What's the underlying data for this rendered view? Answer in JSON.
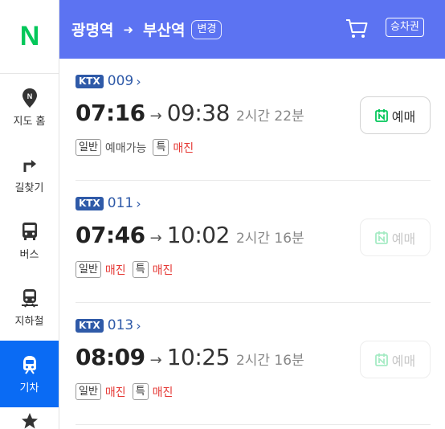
{
  "sidebar": {
    "logo": "N",
    "items": [
      {
        "label": "지도 홈",
        "icon": "map-pin-icon"
      },
      {
        "label": "길찾기",
        "icon": "turn-right-arrow-icon"
      },
      {
        "label": "버스",
        "icon": "bus-icon"
      },
      {
        "label": "지하철",
        "icon": "subway-icon"
      },
      {
        "label": "기차",
        "icon": "train-icon",
        "active": true
      }
    ]
  },
  "header": {
    "from": "광명역",
    "to": "부산역",
    "arrow": "➜",
    "change_label": "변경",
    "ticket_label": "승차권"
  },
  "trains": [
    {
      "type": "KTX",
      "number": "009",
      "departure": "07:16",
      "arrival": "09:38",
      "duration": "2시간 22분",
      "general_label": "일반",
      "general_status": "예매가능",
      "special_label": "특",
      "special_status": "매진",
      "book_label": "예매",
      "bookable": true
    },
    {
      "type": "KTX",
      "number": "011",
      "departure": "07:46",
      "arrival": "10:02",
      "duration": "2시간 16분",
      "general_label": "일반",
      "general_status": "매진",
      "special_label": "특",
      "special_status": "매진",
      "book_label": "예매",
      "bookable": false
    },
    {
      "type": "KTX",
      "number": "013",
      "departure": "08:09",
      "arrival": "10:25",
      "duration": "2시간 16분",
      "general_label": "일반",
      "general_status": "매진",
      "special_label": "특",
      "special_status": "매진",
      "book_label": "예매",
      "bookable": false
    }
  ],
  "colors": {
    "header_bg": "#5c73f2",
    "active_nav": "#0a6bf4",
    "naver_green": "#03c75a",
    "ktx_blue": "#2f5aa8",
    "soldout_red": "#e53935"
  }
}
